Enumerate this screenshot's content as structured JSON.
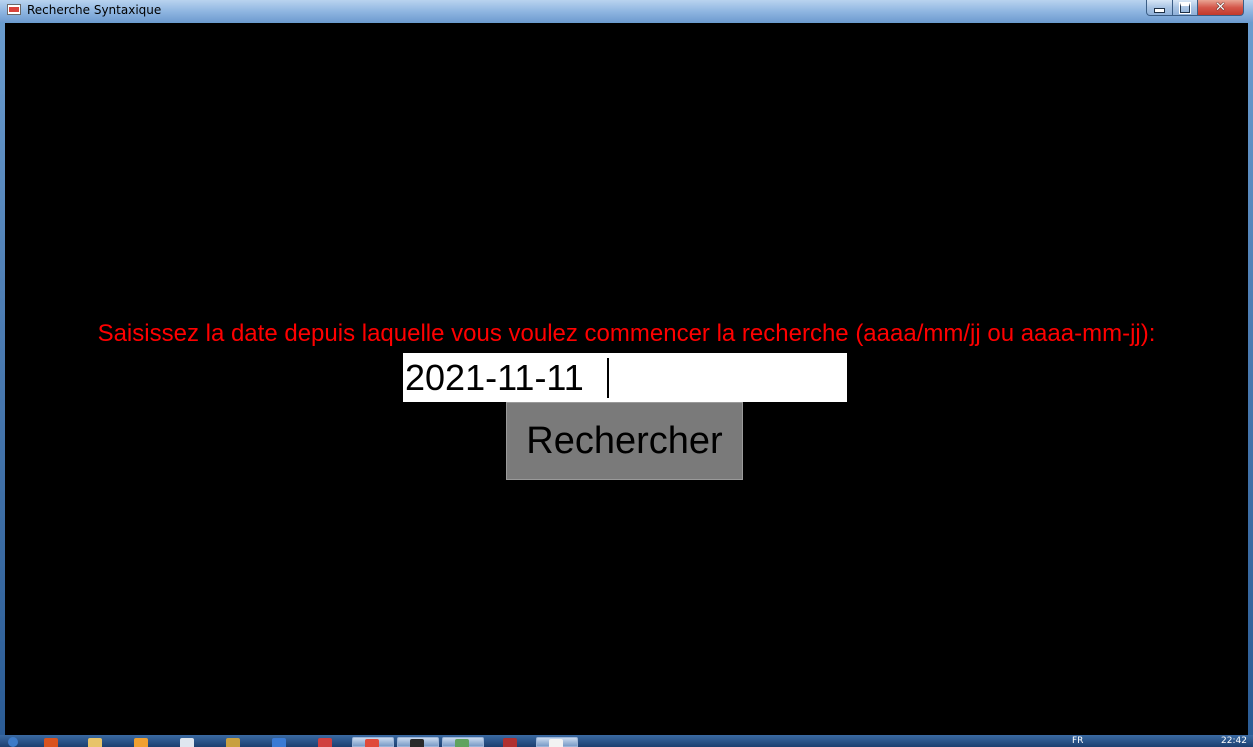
{
  "window": {
    "title": "Recherche Syntaxique",
    "controls": {
      "minimize": "minimize",
      "maximize": "maximize",
      "close": "✕"
    }
  },
  "form": {
    "prompt": "Saisissez la date depuis laquelle vous voulez commencer la recherche (aaaa/mm/jj ou aaaa-mm-jj):",
    "date_value": "2021-11-11",
    "search_button_label": "Rechercher"
  },
  "colors": {
    "background": "#000000",
    "prompt_text": "#ff0000",
    "input_background": "#ffffff",
    "button_background": "#7a7a7a"
  },
  "taskbar": {
    "icons": [
      "start-orb-icon",
      "firefox-icon",
      "folder-icon",
      "media-icon",
      "document-icon",
      "app-icon",
      "vs-icon",
      "mail-icon",
      "chrome-icon",
      "terminal-icon",
      "network-icon",
      "app-red-icon",
      "recherche-window-icon"
    ],
    "language": "FR",
    "clock": "22:42"
  }
}
